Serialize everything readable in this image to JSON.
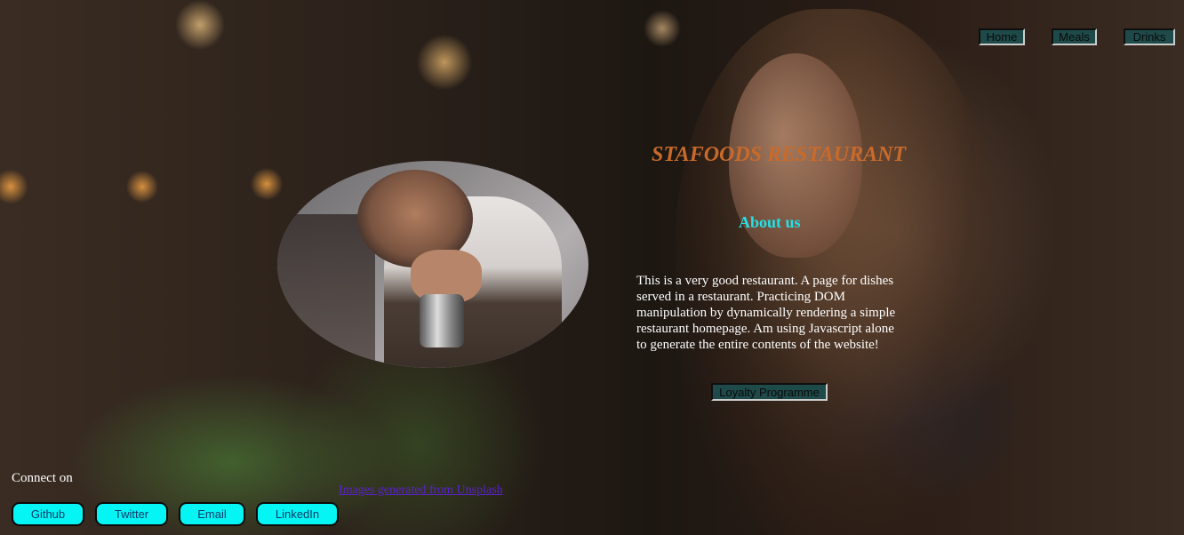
{
  "nav": {
    "items": [
      {
        "label": "Home"
      },
      {
        "label": "Meals"
      },
      {
        "label": "Drinks"
      }
    ]
  },
  "hero": {
    "title": "STAFOODS RESTAURANT",
    "about_heading": "About us",
    "description": "This is a very good restaurant. A page for dishes served in a restaurant. Practicing DOM manipulation by dynamically rendering a simple restaurant homepage. Am using Javascript alone to generate the entire contents of the website!",
    "loyalty_button": "Loyalty Programme"
  },
  "footer": {
    "connect_label": "Connect on",
    "credit_link": "Images generated from Unsplash",
    "social": [
      {
        "label": "Github"
      },
      {
        "label": "Twitter"
      },
      {
        "label": "Email"
      },
      {
        "label": "LinkedIn"
      }
    ]
  },
  "colors": {
    "title": "#c96a2a",
    "about": "#24e0e6",
    "nav_bg": "#1f4a4a",
    "social_bg": "#05f5f5",
    "link": "#5b22c9"
  }
}
